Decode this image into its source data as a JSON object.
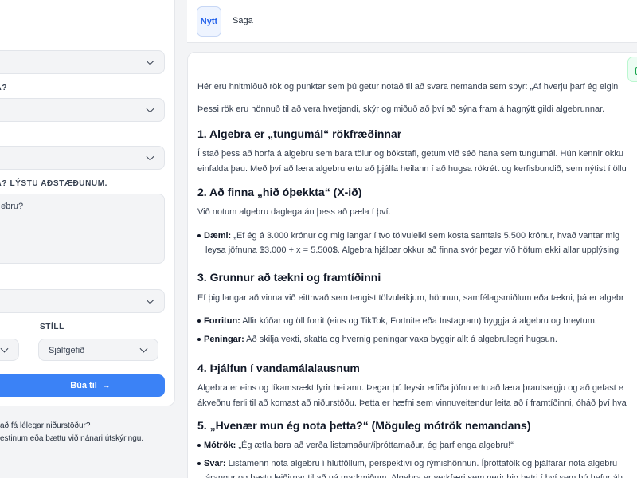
{
  "sidebar": {
    "label_1": "OJA?",
    "label_2": "OJA? LÝSTU AÐSTÆÐUNUM.",
    "textarea_value": "ebru?",
    "label_style": "STÍLL",
    "style_value": "Sjálfgefið",
    "create_button": "Búa til",
    "create_arrow": "→",
    "hint_line1": "að fá lélegar niðurstöður?",
    "hint_line2": "estinum eða bættu við nánari útskýringu."
  },
  "tabs": {
    "new": "Nýtt",
    "history": "Saga"
  },
  "content": {
    "intro": "Hér eru hnitmiðuð rök og punktar sem þú getur notað til að svara nemanda sem spyr: „Af hverju þarf ég eiginl",
    "intro2": "Þessi rök eru hönnuð til að vera hvetjandi, skýr og miðuð að því að sýna fram á hagnýtt gildi algebrunnar.",
    "h1": "1. Algebra er „tungumál“ rökfræðinnar",
    "p1a": "Í stað þess að horfa á algebru sem bara tölur og bókstafi, getum við séð hana sem tungumál. Hún kennir okku",
    "p1b": "einfalda þau. Með því að læra algebru ertu að þjálfa heilann í að hugsa rökrétt og kerfisbundið, sem nýtist í öllu",
    "h2": "2. Að finna „hið óþekkta“ (X-ið)",
    "p2": "Við notum algebru daglega án þess að pæla í því.",
    "b2_label": "Dæmi:",
    "b2_text": " „Ef ég á 3.000 krónur og mig langar í tvo tölvuleiki sem kosta samtals 5.500 krónur, hvað vantar mig",
    "b2_cont": "leysa jöfnuna $3.000 + x = 5.500$. Algebra hjálpar okkur að finna svör þegar við höfum ekki allar upplýsing",
    "h3": "3. Grunnur að tækni og framtíðinni",
    "p3": "Ef þig langar að vinna við eitthvað sem tengist tölvuleikjum, hönnun, samfélagsmiðlum eða tækni, þá er algebr",
    "b3a_label": "Forritun:",
    "b3a_text": " Allir kóðar og öll forrit (eins og TikTok, Fortnite eða Instagram) byggja á algebru og breytum.",
    "b3b_label": "Peningar:",
    "b3b_text": " Að skilja vexti, skatta og hvernig peningar vaxa byggir allt á algebrulegri hugsun.",
    "h4": "4. Þjálfun í vandamálalausnum",
    "p4a": "Algebra er eins og líkamsrækt fyrir heilann. Þegar þú leysir erfiða jöfnu ertu að læra þrautseigju og að gefast e",
    "p4b": "ákveðnu ferli til að komast að niðurstöðu. Þetta er hæfni sem vinnuveitendur leita að í framtíðinni, óháð því hva",
    "h5": "5. „Hvenær mun ég nota þetta?“ (Möguleg mótrök nemandans)",
    "b5a_label": "Mótrök:",
    "b5a_text": " „Ég ætla bara að verða listamaður/íþróttamaður, ég þarf enga algebru!“",
    "b5b_label": "Svar:",
    "b5b_text": " Listamenn nota algebru í hlutföllum, perspektívi og rýmishönnun. Íþróttafólk og þjálfarar nota algebru",
    "b5b_cont": "árangur og bestu leiðirnar til að ná markmiðum. Algebra er verkfæri sem gerir þig betri í því sem þú hefur áh"
  }
}
